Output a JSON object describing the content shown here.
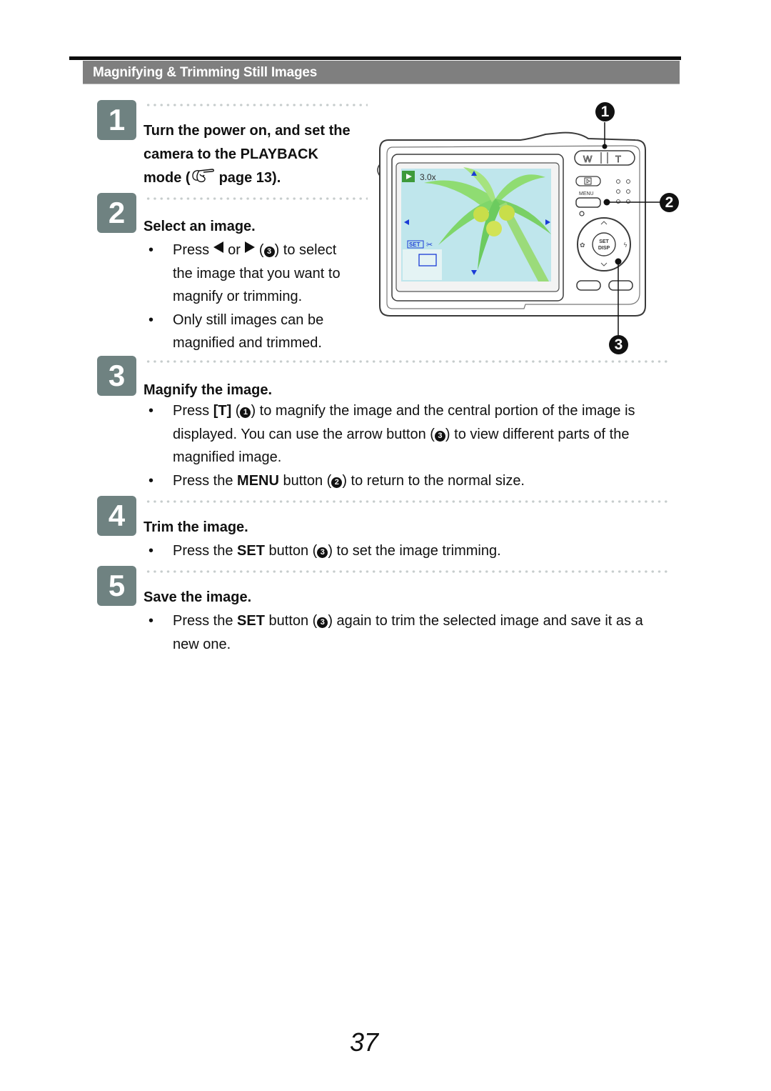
{
  "header": {
    "section_title": "Magnifying & Trimming Still Images"
  },
  "steps": [
    {
      "number": "1",
      "title_parts": [
        "Turn the power on, and set the",
        "camera to the PLAYBACK",
        "mode (",
        "page 13)."
      ],
      "reference_icon": "pointing-hand-icon"
    },
    {
      "number": "2",
      "title": "Select an image.",
      "bullets": [
        {
          "pre": "Press",
          "mid": "or",
          "ref": "3",
          "post": ") to select",
          "line2": "the image that you want to",
          "line3": "magnify or trimming.",
          "icons": [
            "left-arrow-icon",
            "right-arrow-icon"
          ]
        },
        {
          "line1": "Only still images can be",
          "line2": "magnified and trimmed."
        }
      ]
    },
    {
      "number": "3",
      "title": "Magnify the image.",
      "bullets": [
        {
          "pre": "Press ",
          "bold": "[T]",
          "ref1": "1",
          "post1": ") to magnify the image and the central portion of the image is",
          "line2_pre": "displayed. You can use the arrow button (",
          "ref2": "3",
          "line2_post": ") to view different parts of the",
          "line3": "magnified image."
        },
        {
          "pre": "Press the ",
          "bold": "MENU",
          "mid": " button (",
          "ref": "2",
          "post": ") to return to the normal size."
        }
      ]
    },
    {
      "number": "4",
      "title": "Trim the image.",
      "bullets": [
        {
          "pre": "Press the ",
          "bold": "SET",
          "mid": " button (",
          "ref": "3",
          "post": ") to set the image trimming."
        }
      ]
    },
    {
      "number": "5",
      "title": "Save the image.",
      "bullets": [
        {
          "pre": "Press the ",
          "bold": "SET",
          "mid": " button (",
          "ref": "3",
          "post": ") again to trim the selected image and save it as a",
          "line2": "new one."
        }
      ]
    }
  ],
  "figure": {
    "description": "Camera back view in playback zoom mode",
    "lcd": {
      "zoom_readout": "3.0x",
      "set_label": "SET",
      "icons": [
        "playback-mode-icon",
        "scissors-icon",
        "up-arrow-icon",
        "down-arrow-icon",
        "left-arrow-icon",
        "right-arrow-icon"
      ]
    },
    "buttons": {
      "wide": "W",
      "tele": "T",
      "menu": "MENU",
      "set": "SET",
      "disp": "DISP"
    },
    "callouts": [
      "1",
      "2",
      "3"
    ]
  },
  "footer": {
    "page_number": "37"
  }
}
